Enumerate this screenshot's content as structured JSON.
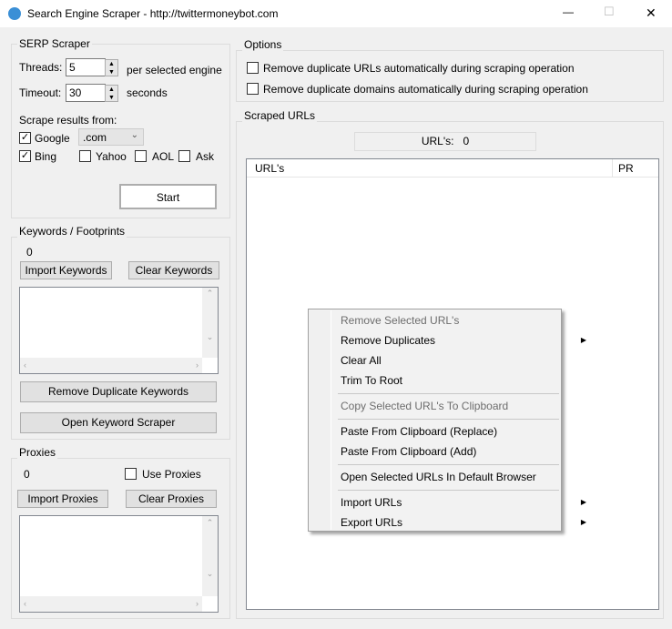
{
  "window": {
    "title": "Search Engine Scraper - http://twittermoneybot.com",
    "minimize": "—",
    "maximize": "☐",
    "close": "✕"
  },
  "serp": {
    "title": "SERP Scraper",
    "threads_label": "Threads:",
    "threads_value": "5",
    "threads_suffix": "per selected engine",
    "timeout_label": "Timeout:",
    "timeout_value": "30",
    "timeout_suffix": "seconds",
    "scrape_from": "Scrape results from:",
    "engines": [
      {
        "label": "Google",
        "checked": true
      },
      {
        "label": "Bing",
        "checked": true
      },
      {
        "label": "Yahoo",
        "checked": false
      },
      {
        "label": "AOL",
        "checked": false
      },
      {
        "label": "Ask",
        "checked": false
      }
    ],
    "google_domain": ".com",
    "start": "Start"
  },
  "keywords": {
    "title": "Keywords / Footprints",
    "count": "0",
    "import": "Import Keywords",
    "clear": "Clear Keywords",
    "remove_dupes": "Remove Duplicate Keywords",
    "open_scraper": "Open Keyword Scraper"
  },
  "proxies": {
    "title": "Proxies",
    "count": "0",
    "use_proxies": "Use Proxies",
    "use_checked": false,
    "import": "Import Proxies",
    "clear": "Clear Proxies"
  },
  "options": {
    "title": "Options",
    "opt1": "Remove duplicate URLs automatically during scraping operation",
    "opt2": "Remove duplicate domains automatically during scraping operation"
  },
  "scraped": {
    "title": "Scraped URLs",
    "count_label": "URL's:",
    "count": "0",
    "col_urls": "URL's",
    "col_pr": "PR"
  },
  "context_menu": {
    "items": [
      {
        "label": "Remove Selected URL's",
        "disabled": true
      },
      {
        "label": "Remove Duplicates",
        "submenu": true
      },
      {
        "label": "Clear All"
      },
      {
        "label": "Trim To Root"
      },
      {
        "label": "Copy Selected URL's To Clipboard",
        "disabled": true
      },
      {
        "label": "Paste From Clipboard (Replace)"
      },
      {
        "label": "Paste From Clipboard (Add)"
      },
      {
        "label": "Open Selected URLs In Default Browser"
      },
      {
        "label": "Import URLs",
        "submenu": true
      },
      {
        "label": "Export URLs",
        "submenu": true
      }
    ]
  }
}
